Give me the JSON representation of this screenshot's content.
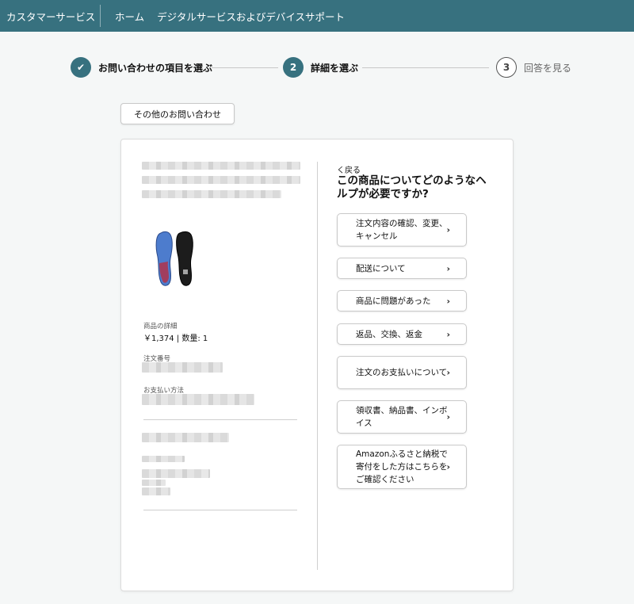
{
  "header": {
    "brand": "カスタマーサービス",
    "nav": [
      "ホーム",
      "デジタルサービスおよびデバイスサポート"
    ]
  },
  "steps": [
    {
      "number": "✔",
      "label": "お問い合わせの項目を選ぶ",
      "state": "done"
    },
    {
      "number": "2",
      "label": "詳細を選ぶ",
      "state": "active"
    },
    {
      "number": "3",
      "label": "回答を見る",
      "state": "todo"
    }
  ],
  "other_inquiry_label": "その他のお問い合わせ",
  "product": {
    "details_label": "商品の詳細",
    "details_value": "￥1,374 | 数量: 1",
    "order_number_label": "注文番号",
    "payment_label": "お支払い方法"
  },
  "help": {
    "back_label": "く戻る",
    "question": "この商品についてどのようなヘルプが必要ですか?",
    "options": [
      "注文内容の確認、変更、キャンセル",
      "配送について",
      "商品に問題があった",
      "返品、交換、返金",
      "注文のお支払いについて",
      "領収書、納品書、インボイス",
      "Amazonふるさと納税で寄付をした方はこちらをご確認ください"
    ],
    "chevron": "›"
  },
  "colors": {
    "header_bg": "#37717f",
    "accent": "#37717f"
  }
}
